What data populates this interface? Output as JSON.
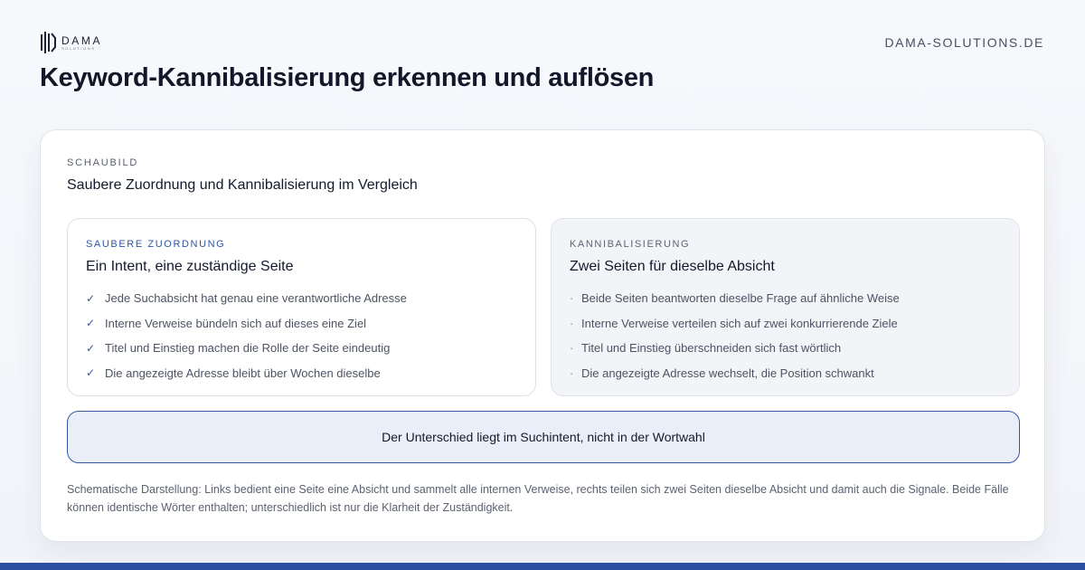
{
  "header": {
    "logo": {
      "word": "DAMA",
      "sub": "SOLUTIONS"
    },
    "domain": "DAMA-SOLUTIONS.DE"
  },
  "page_title": "Keyword-Kannibalisierung erkennen und auflösen",
  "figure": {
    "eyebrow": "SCHAUBILD",
    "title": "Saubere Zuordnung und Kannibalisierung im Vergleich",
    "clean": {
      "label": "SAUBERE ZUORDNUNG",
      "heading": "Ein Intent, eine zuständige Seite",
      "marker_icon": "checkmark-icon",
      "items": [
        "Jede Suchabsicht hat genau eine verantwortliche Adresse",
        "Interne Verweise bündeln sich auf dieses eine Ziel",
        "Titel und Einstieg machen die Rolle der Seite eindeutig",
        "Die angezeigte Adresse bleibt über Wochen dieselbe"
      ]
    },
    "cannibal": {
      "label": "KANNIBALISIERUNG",
      "heading": "Zwei Seiten für dieselbe Absicht",
      "marker_icon": "bullet-dot-icon",
      "items": [
        "Beide Seiten beantworten dieselbe Frage auf ähnliche Weise",
        "Interne Verweise verteilen sich auf zwei konkurrierende Ziele",
        "Titel und Einstieg überschneiden sich fast wörtlich",
        "Die angezeigte Adresse wechselt, die Position schwankt"
      ]
    },
    "callout": "Der Unterschied liegt im Suchintent, nicht in der Wortwahl",
    "footnote": "Schematische Darstellung: Links bedient eine Seite eine Absicht und sammelt alle internen Verweise, rechts teilen sich zwei Seiten dieselbe Absicht und damit auch die Signale. Beide Fälle können identische Wörter enthalten; unterschiedlich ist nur die Klarheit der Zuständigkeit."
  },
  "colors": {
    "accent": "#2f55a8",
    "bottom_bar": "#2c4ea2",
    "callout_bg": "#e9eef9"
  }
}
